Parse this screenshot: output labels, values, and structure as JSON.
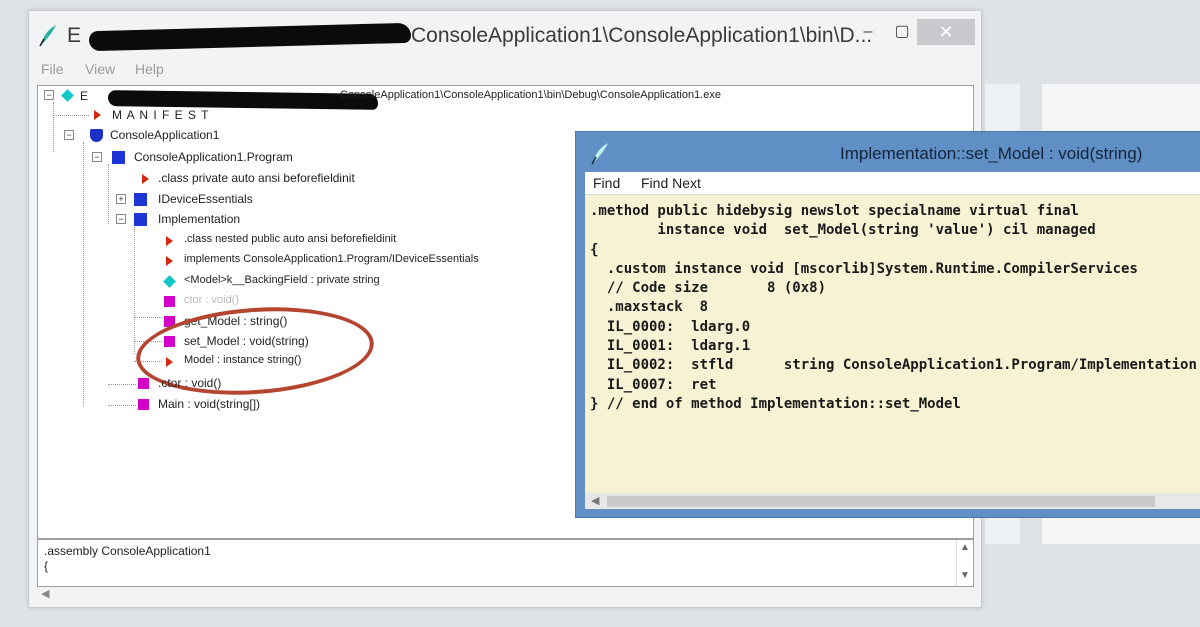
{
  "window": {
    "title_prefix": "E",
    "title_path": "ConsoleApplication1\\ConsoleApplication1\\bin\\D...",
    "minimize": "–",
    "maximize": "▢",
    "close": "✕"
  },
  "menu": [
    "File",
    "View",
    "Help"
  ],
  "tree": {
    "root_prefix": "E",
    "root_path": "ConsoleApplication1\\ConsoleApplication1\\bin\\Debug\\ConsoleApplication1.exe",
    "manifest": "M A N I F E S T",
    "assembly": "ConsoleApplication1",
    "program_class": "ConsoleApplication1.Program",
    "program_class_decl": ".class private auto ansi beforefieldinit",
    "interface": "IDeviceEssentials",
    "implementation": "Implementation",
    "impl_class_decl": ".class nested public auto ansi beforefieldinit",
    "impl_implements": "implements ConsoleApplication1.Program/IDeviceEssentials",
    "backing_field": "<Model>k__BackingField : private string",
    "ctor_partial": "ctor : void()",
    "get_model": "get_Model : string()",
    "set_model": "set_Model : void(string)",
    "model_property": "Model : instance string()",
    "ctor": ".ctor : void()",
    "main": "Main : void(string[])"
  },
  "bottom_pane": {
    "line1": ".assembly ConsoleApplication1",
    "line2": "{"
  },
  "popup": {
    "title": "Implementation::set_Model : void(string)",
    "menu": [
      "Find",
      "Find Next"
    ],
    "code": [
      ".method public hidebysig newslot specialname virtual final",
      "        instance void  set_Model(string 'value') cil managed",
      "{",
      "  .custom instance void [mscorlib]System.Runtime.CompilerServices",
      "  // Code size       8 (0x8)",
      "  .maxstack  8",
      "  IL_0000:  ldarg.0",
      "  IL_0001:  ldarg.1",
      "  IL_0002:  stfld      string ConsoleApplication1.Program/Implementation",
      "  IL_0007:  ret",
      "} // end of method Implementation::set_Model"
    ]
  },
  "colors": {
    "popup_frame": "#5f8fc4",
    "code_background": "#f7f2d3",
    "annotation_circle": "#b5452e"
  }
}
